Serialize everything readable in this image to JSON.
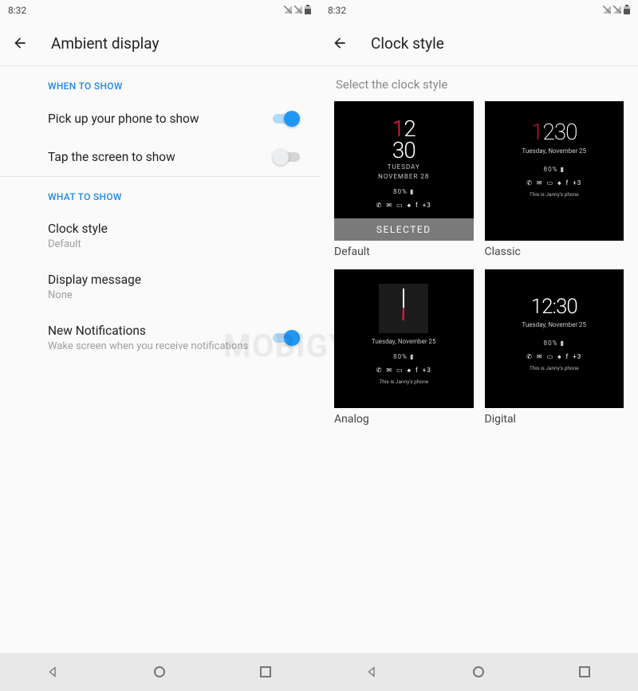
{
  "status": {
    "time": "8:32"
  },
  "left": {
    "title": "Ambient display",
    "section1": "WHEN TO SHOW",
    "pickup": {
      "label": "Pick up your phone to show",
      "on": true
    },
    "tap": {
      "label": "Tap the screen to show",
      "on": false
    },
    "section2": "WHAT TO SHOW",
    "clockStyle": {
      "label": "Clock style",
      "value": "Default"
    },
    "displayMessage": {
      "label": "Display message",
      "value": "None"
    },
    "newNotifications": {
      "label": "New Notifications",
      "sub": "Wake screen when you receive notifications",
      "on": true
    }
  },
  "right": {
    "title": "Clock style",
    "subtitle": "Select the clock style",
    "selectedLabel": "SELECTED",
    "tiles": {
      "default": {
        "name": "Default",
        "time_top": "12",
        "time_bottom": "30",
        "day": "TUESDAY",
        "date": "NOVEMBER 28",
        "battery": "80%",
        "plus": "+3",
        "selected": true
      },
      "classic": {
        "name": "Classic",
        "time": "1230",
        "date": "Tuesday, November  25",
        "battery": "80%",
        "plus": "+3",
        "footer": "This is Janny's phone"
      },
      "analog": {
        "name": "Analog",
        "date": "Tuesday, November  25",
        "battery": "80%",
        "plus": "+3",
        "footer": "This is Janny's phone"
      },
      "digital": {
        "name": "Digital",
        "time": "12:30",
        "date": "Tuesday, November  25",
        "battery": "80%",
        "plus": "+3",
        "footer": "This is Janny's phone"
      }
    }
  },
  "watermark": "MOBIGYAAN"
}
